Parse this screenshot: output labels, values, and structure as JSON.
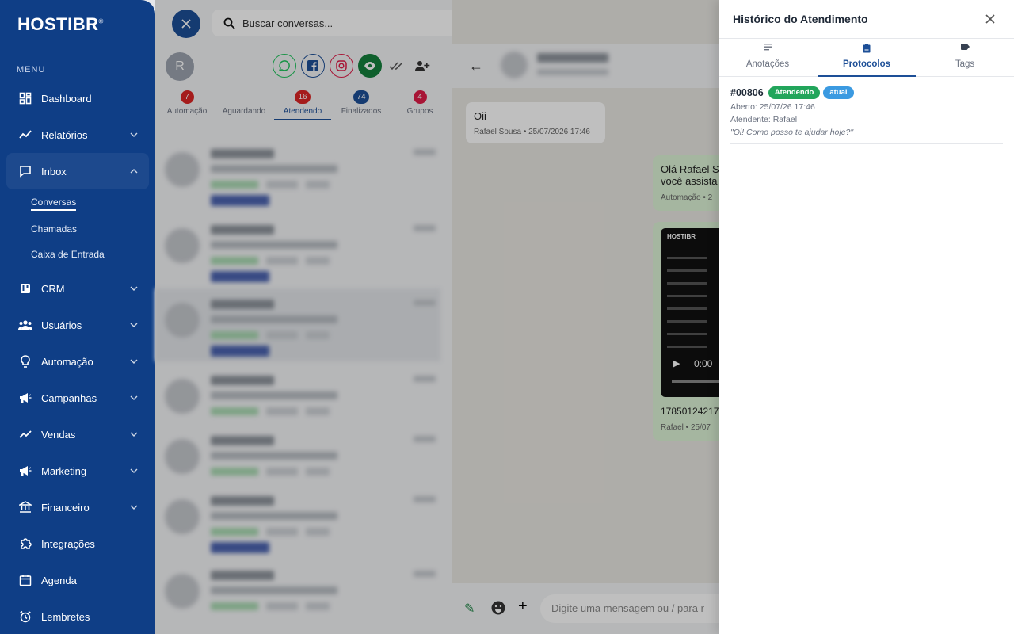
{
  "brand": {
    "logo": "HOSTIBR",
    "reg": "®"
  },
  "sidebar": {
    "menu_label": "MENU",
    "items": [
      {
        "label": "Dashboard"
      },
      {
        "label": "Relatórios"
      },
      {
        "label": "Inbox",
        "sub": [
          "Conversas",
          "Chamadas",
          "Caixa de Entrada"
        ]
      },
      {
        "label": "CRM"
      },
      {
        "label": "Usuários"
      },
      {
        "label": "Automação"
      },
      {
        "label": "Campanhas"
      },
      {
        "label": "Vendas"
      },
      {
        "label": "Marketing"
      },
      {
        "label": "Financeiro"
      },
      {
        "label": "Integrações"
      },
      {
        "label": "Agenda"
      },
      {
        "label": "Lembretes"
      }
    ]
  },
  "conversations": {
    "search_placeholder": "Buscar conversas...",
    "user_initial": "R",
    "tabs": [
      {
        "label": "Automação",
        "count": "7",
        "color": "#dc2626"
      },
      {
        "label": "Aguardando",
        "count": "",
        "color": ""
      },
      {
        "label": "Atendendo",
        "count": "16",
        "color": "#dc2626"
      },
      {
        "label": "Finalizados",
        "count": "74",
        "color": "#1d4f97"
      },
      {
        "label": "Grupos",
        "count": "4",
        "color": "#e11d48"
      }
    ]
  },
  "chat": {
    "incoming": {
      "text": "Oii",
      "meta": "Rafael Sousa • 25/07/2026 17:46"
    },
    "outgoing": {
      "text_line1": "Olá Rafael S",
      "text_line2": "você assista",
      "meta": "Automação • 2"
    },
    "video": {
      "logo": "HOSTIBR",
      "time": "0:00",
      "filename": "17850124217",
      "meta": "Rafael • 25/07"
    },
    "composer_placeholder": "Digite uma mensagem ou / para r"
  },
  "drawer": {
    "title": "Histórico do Atendimento",
    "tabs": [
      "Anotações",
      "Protocolos",
      "Tags"
    ],
    "protocol": {
      "id": "#00806",
      "status": "Atendendo",
      "current": "atual",
      "opened": "Aberto: 25/07/26 17:46",
      "agent": "Atendente: Rafael",
      "quote": "\"Oi! Como posso te ajudar hoje?\""
    }
  },
  "colors": {
    "sidebar": "#0f3e86",
    "accent": "#1d4f97",
    "status_green": "#22a55b",
    "current_blue": "#3b9ae1"
  }
}
